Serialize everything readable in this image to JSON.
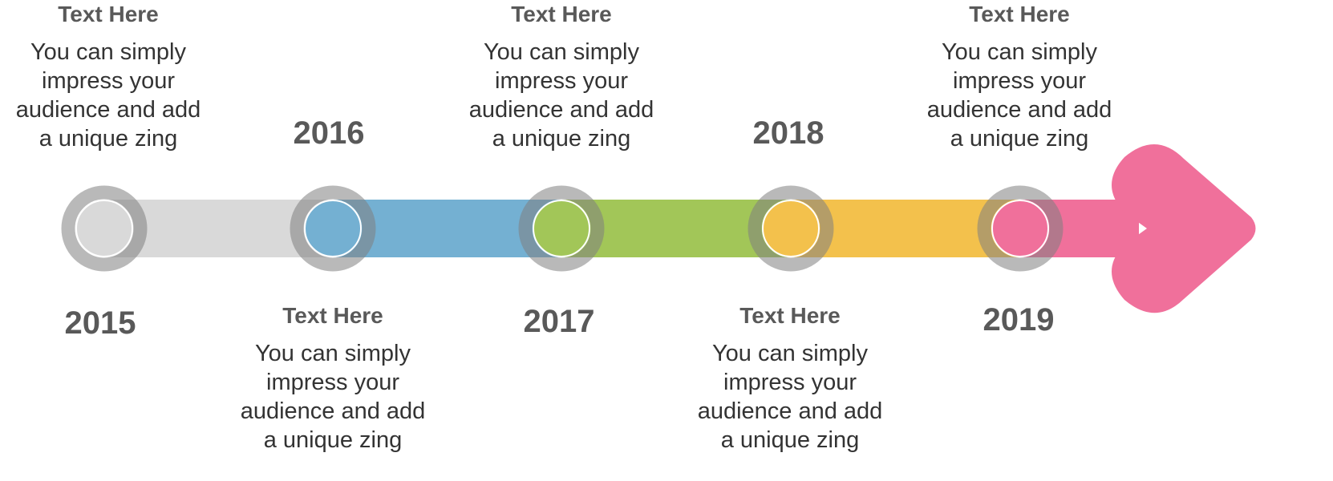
{
  "timeline": {
    "milestones": [
      {
        "year": "2015",
        "color": "#d9d9d9",
        "heading": "Text  Here",
        "body": [
          "You can simply",
          "impress your",
          "audience and add",
          "a unique zing"
        ]
      },
      {
        "year": "2016",
        "color": "#74b0d2",
        "heading": "Text  Here",
        "body": [
          "You can simply",
          "impress your",
          "audience and add",
          "a unique zing"
        ]
      },
      {
        "year": "2017",
        "color": "#a2c658",
        "heading": "Text  Here",
        "body": [
          "You can simply",
          "impress your",
          "audience and add",
          "a unique zing"
        ]
      },
      {
        "year": "2018",
        "color": "#f3c14c",
        "heading": "Text  Here",
        "body": [
          "You can simply",
          "impress your",
          "audience and add",
          "a unique zing"
        ]
      },
      {
        "year": "2019",
        "color": "#f0709b",
        "heading": "Text  Here",
        "body": [
          "You can simply",
          "impress your",
          "audience and add",
          "a unique zing"
        ]
      }
    ],
    "arrow_color": "#f0709b",
    "ring_color": "#808080"
  }
}
